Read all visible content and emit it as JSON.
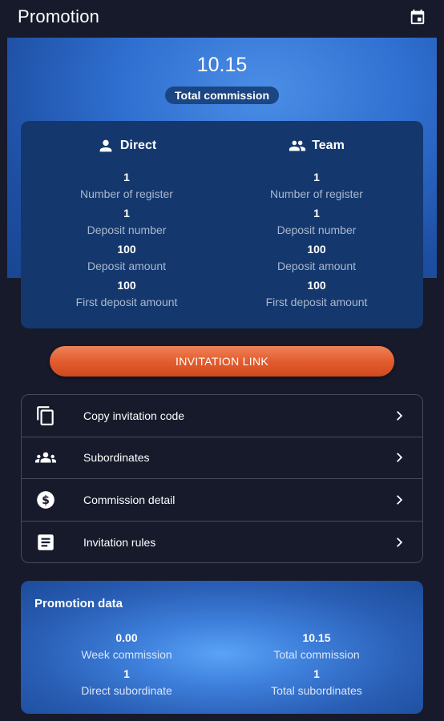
{
  "header": {
    "title": "Promotion",
    "calendar_icon": "calendar-icon"
  },
  "hero": {
    "amount": "10.15",
    "label": "Total commission"
  },
  "stats": {
    "direct": {
      "title": "Direct",
      "icon": "person-icon",
      "items": [
        {
          "value": "1",
          "label": "Number of register"
        },
        {
          "value": "1",
          "label": "Deposit number"
        },
        {
          "value": "100",
          "label": "Deposit amount"
        },
        {
          "value": "100",
          "label": "First deposit amount"
        }
      ]
    },
    "team": {
      "title": "Team",
      "icon": "group-icon",
      "items": [
        {
          "value": "1",
          "label": "Number of register"
        },
        {
          "value": "1",
          "label": "Deposit number"
        },
        {
          "value": "100",
          "label": "Deposit amount"
        },
        {
          "value": "100",
          "label": "First deposit amount"
        }
      ]
    }
  },
  "invite_button": {
    "label": "INVITATION LINK"
  },
  "menu": {
    "items": [
      {
        "label": "Copy invitation code",
        "icon": "copy-icon"
      },
      {
        "label": "Subordinates",
        "icon": "people-icon"
      },
      {
        "label": "Commission detail",
        "icon": "dollar-icon"
      },
      {
        "label": "Invitation rules",
        "icon": "document-icon"
      }
    ]
  },
  "promotion_data": {
    "title": "Promotion data",
    "left": [
      {
        "value": "0.00",
        "label": "Week commission"
      },
      {
        "value": "1",
        "label": "Direct subordinate"
      }
    ],
    "right": [
      {
        "value": "10.15",
        "label": "Total commission"
      },
      {
        "value": "1",
        "label": "Total subordinates"
      }
    ]
  },
  "colors": {
    "background": "#161a2b",
    "hero_blue": "#2f6fd0",
    "stats_card": "#14386d",
    "button_orange": "#e35d2f",
    "muted_text": "#a9b7cf"
  }
}
